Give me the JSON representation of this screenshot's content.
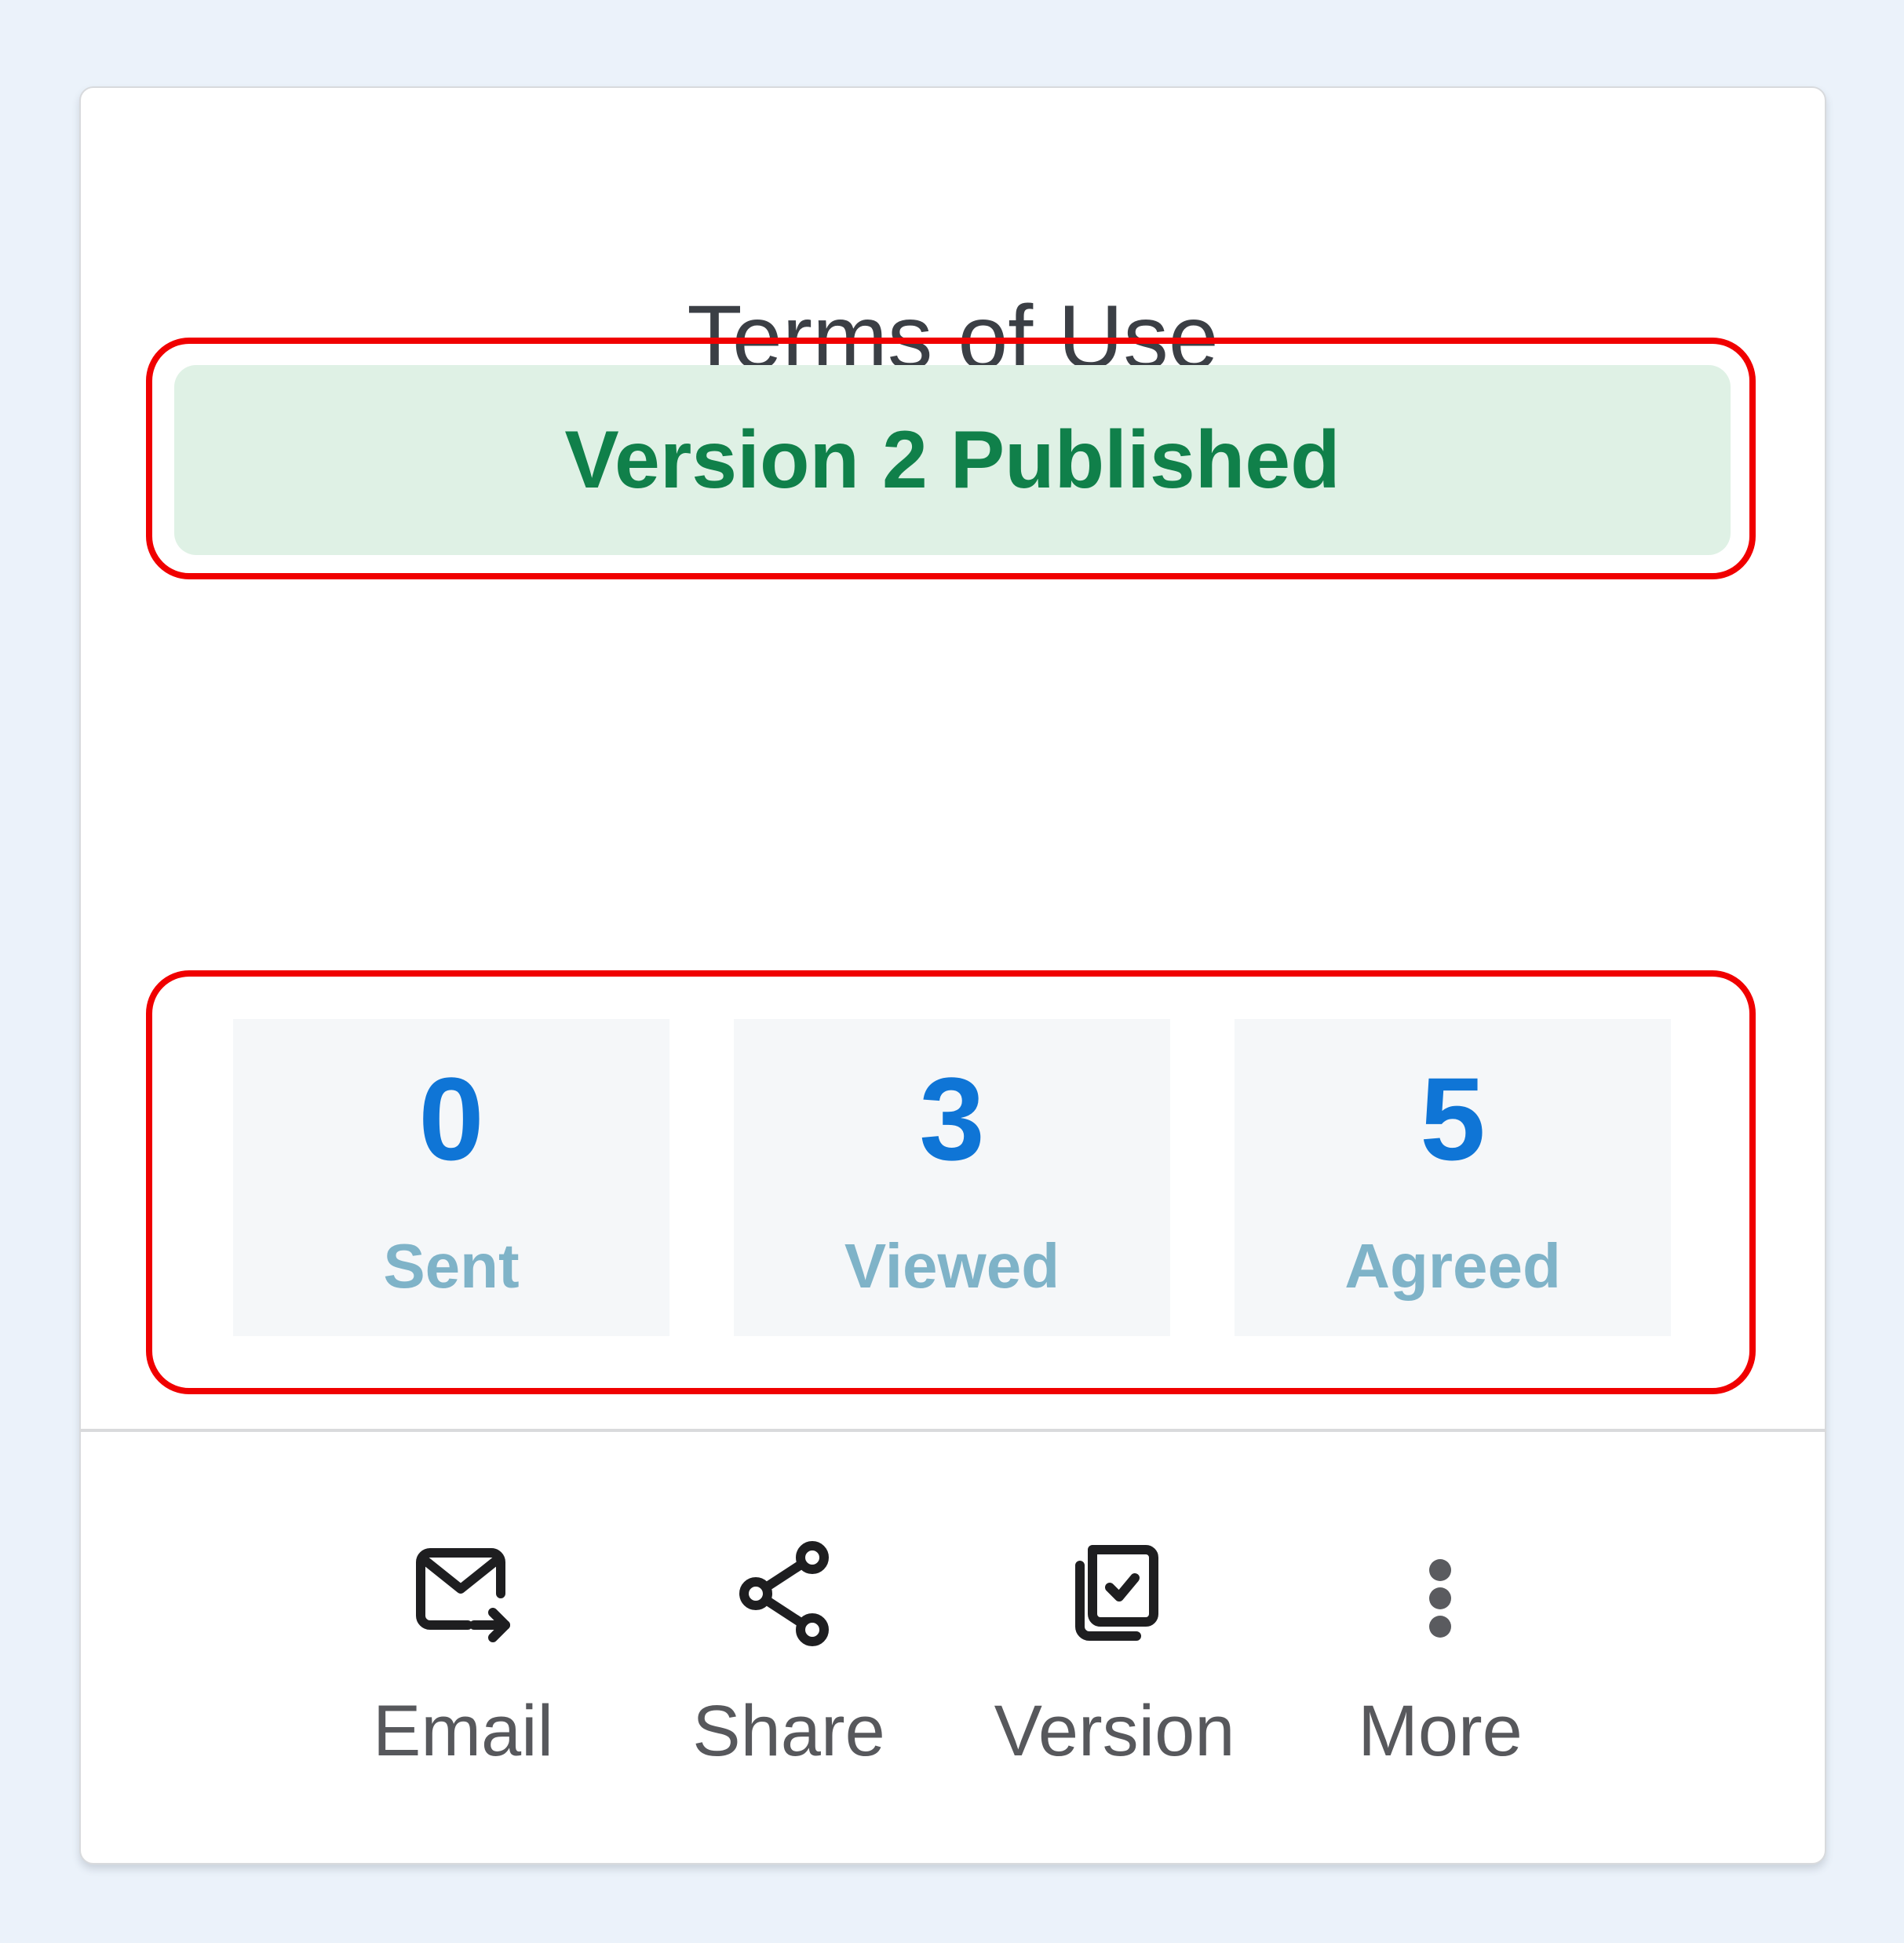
{
  "card": {
    "title": "Terms of Use",
    "status": "Version 2 Published",
    "stats": [
      {
        "value": "0",
        "label": "Sent"
      },
      {
        "value": "3",
        "label": "Viewed"
      },
      {
        "value": "5",
        "label": "Agreed"
      }
    ],
    "actions": [
      {
        "label": "Email",
        "icon": "email-send-icon"
      },
      {
        "label": "Share",
        "icon": "share-icon"
      },
      {
        "label": "Version",
        "icon": "version-copy-icon"
      },
      {
        "label": "More",
        "icon": "more-vertical-icon"
      }
    ]
  },
  "colors": {
    "page_background": "#ebf2fa",
    "status_text": "#10804a",
    "status_background": "#dff1e5",
    "stat_value": "#0f75d6",
    "stat_label": "#7fb3c8",
    "highlight_border": "#f00000"
  }
}
